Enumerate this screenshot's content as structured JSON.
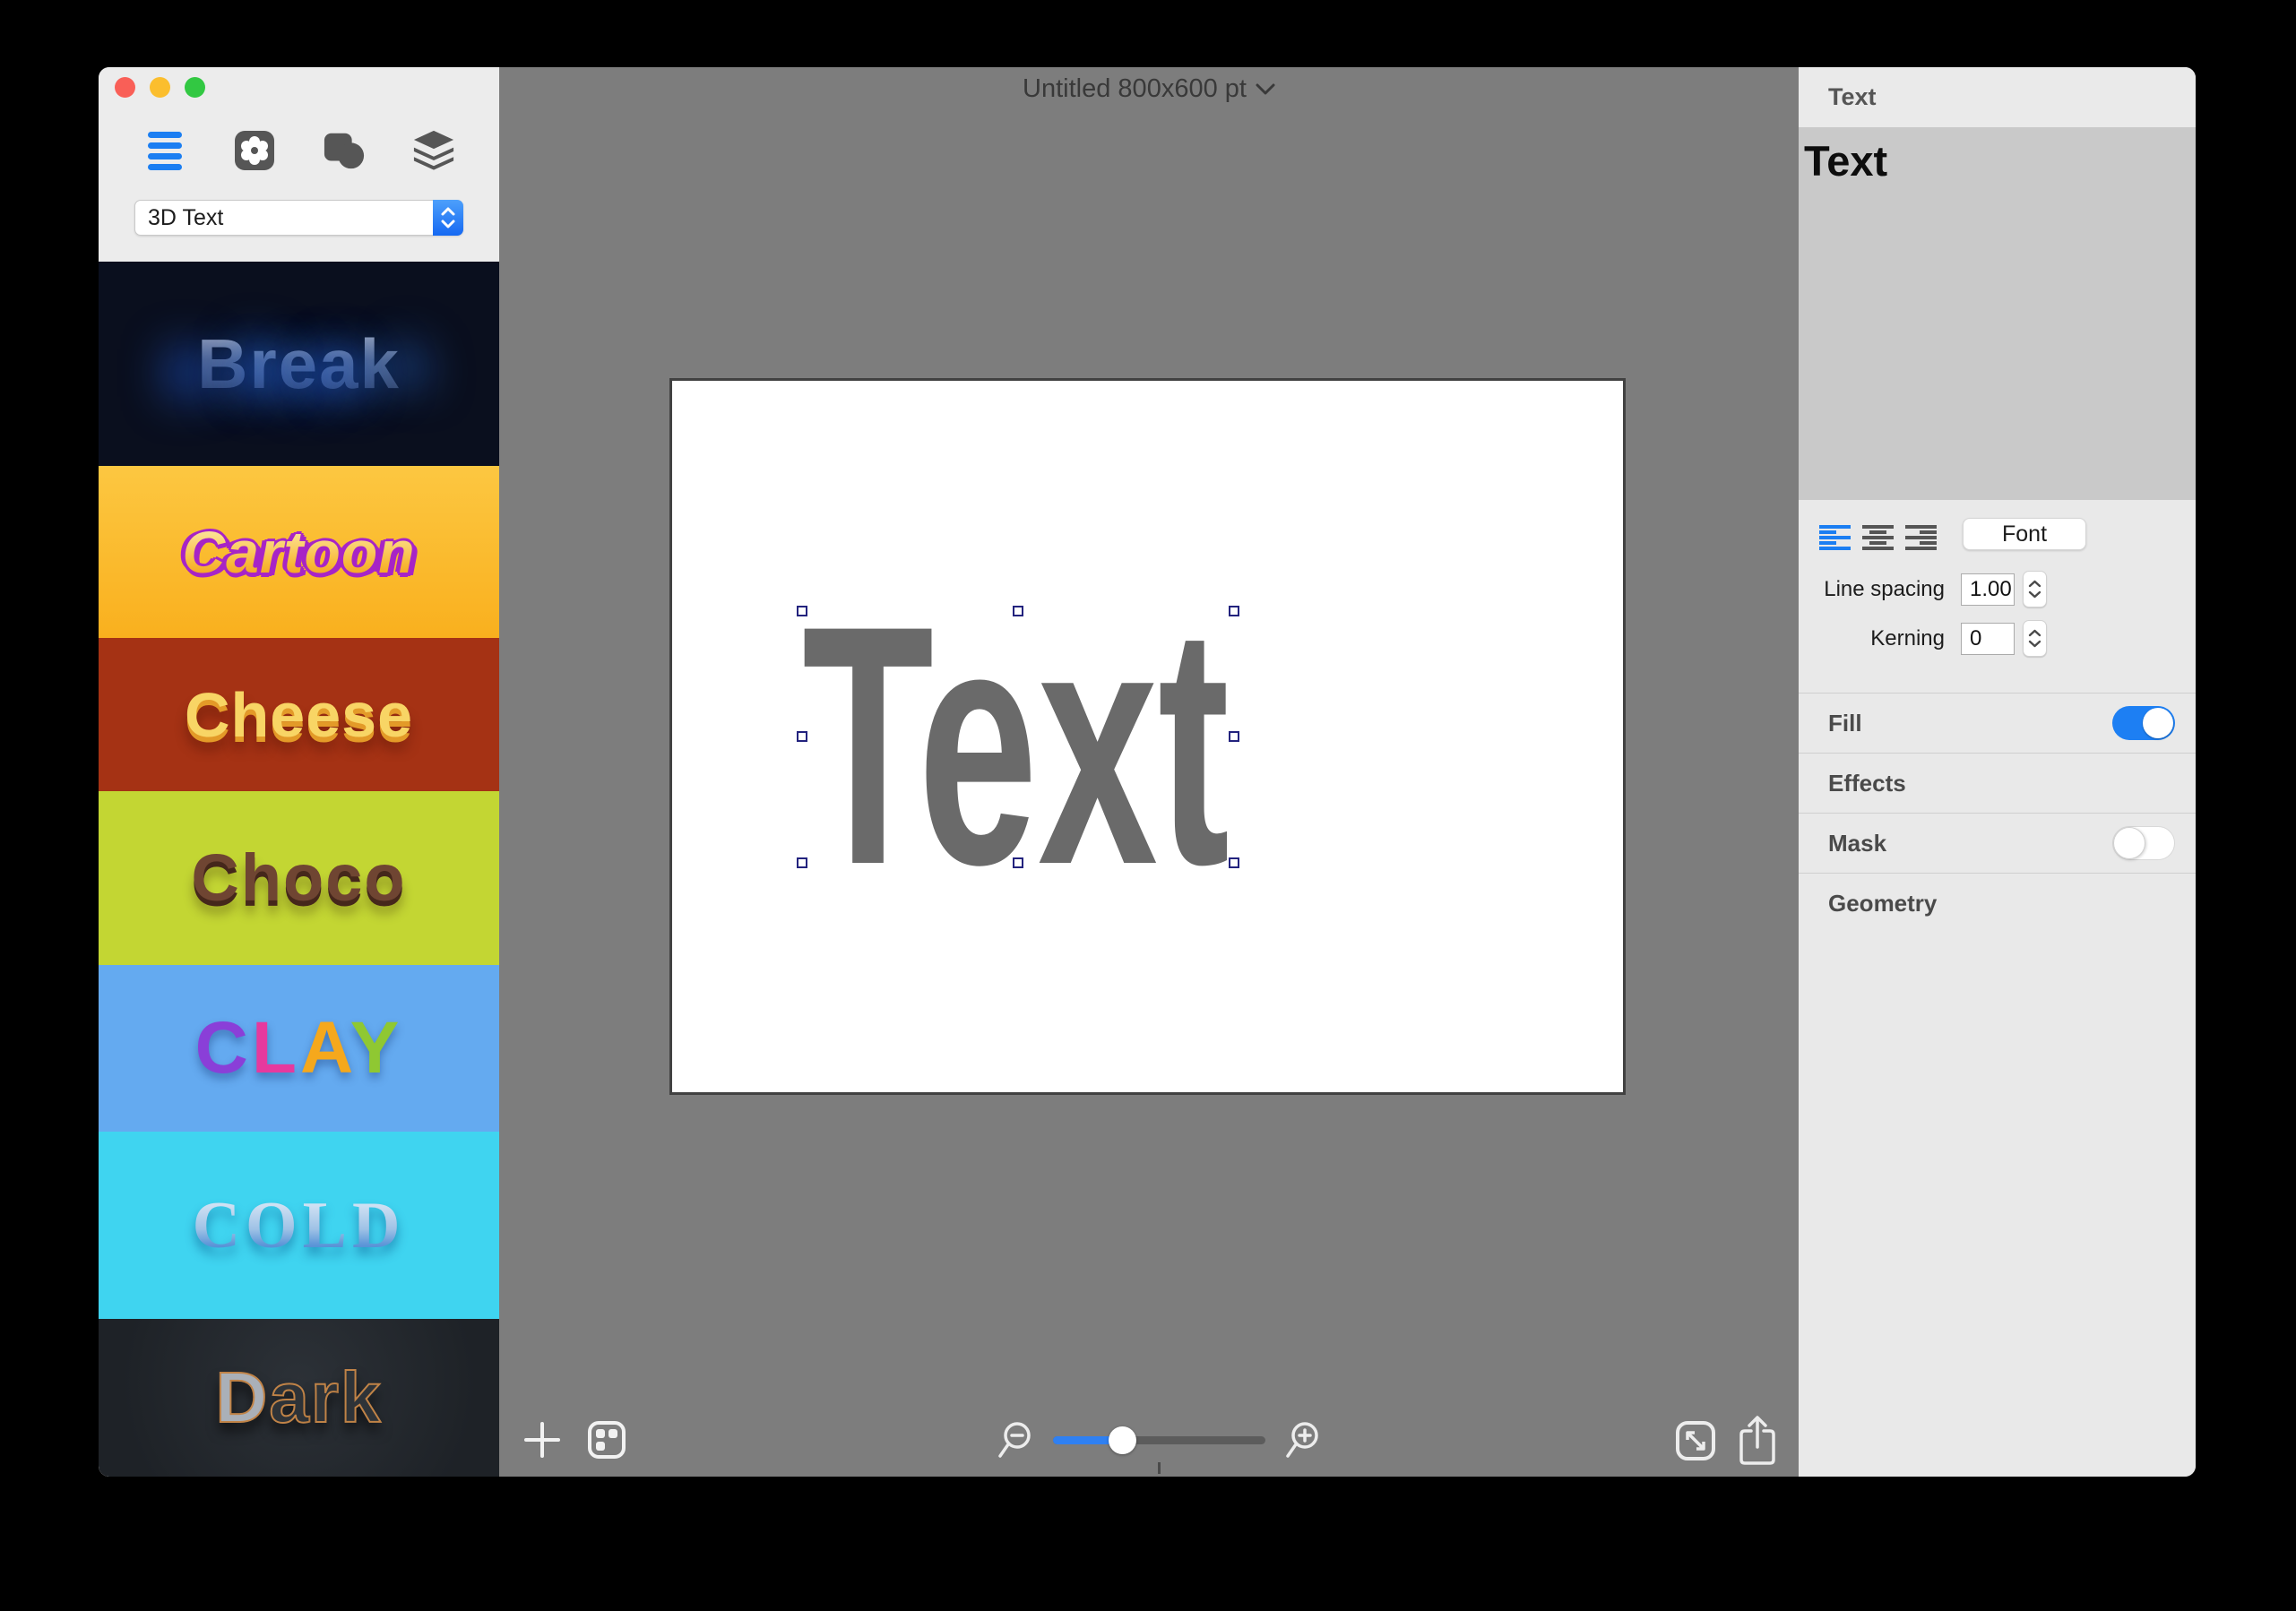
{
  "window": {
    "title": "Untitled 800x600 pt",
    "traffic_lights": {
      "close": "#f95f57",
      "minimize": "#fbbe2e",
      "zoom": "#32c842"
    }
  },
  "sidebar": {
    "dropdown_value": "3D Text",
    "presets": [
      {
        "label": "Break",
        "style": "break",
        "bg": "#0a0f1e"
      },
      {
        "label": "Cartoon",
        "style": "cartoon",
        "bg": ""
      },
      {
        "label": "Cheese",
        "style": "cheese",
        "bg": "#a53214"
      },
      {
        "label": "Choco",
        "style": "choco",
        "bg": "#c3d633"
      },
      {
        "label": "CLAY",
        "style": "clay",
        "bg": "#64aaf0",
        "letters": [
          {
            "ch": "C",
            "color": "#8a3fd8"
          },
          {
            "ch": "L",
            "color": "#e6399e"
          },
          {
            "ch": "A",
            "color": "#f5a81c"
          },
          {
            "ch": "Y",
            "color": "#8fc832"
          }
        ]
      },
      {
        "label": "COLD",
        "style": "cold",
        "bg": "#3fd4f0"
      },
      {
        "label": "Dark",
        "style": "dark",
        "bg": "",
        "letters": [
          {
            "ch": "D",
            "color": "#aab0b8"
          },
          {
            "ch": "a",
            "color": "#2e3338"
          },
          {
            "ch": "r",
            "color": "#2e3338"
          },
          {
            "ch": "k",
            "color": "#2e3338"
          }
        ]
      }
    ]
  },
  "canvas": {
    "text": "Text",
    "accent_blue": "#2f80f2"
  },
  "inspector": {
    "header": "Text",
    "content_text": "Text",
    "font_button": "Font",
    "line_spacing_label": "Line spacing",
    "line_spacing_value": "1.00",
    "kerning_label": "Kerning",
    "kerning_value": "0",
    "sections": [
      {
        "label": "Fill",
        "toggle": "on"
      },
      {
        "label": "Effects",
        "toggle": null
      },
      {
        "label": "Mask",
        "toggle": "off"
      },
      {
        "label": "Geometry",
        "toggle": null
      }
    ]
  }
}
